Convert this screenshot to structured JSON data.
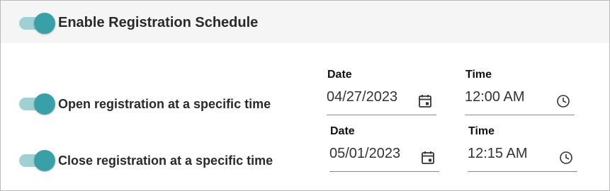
{
  "header": {
    "title": "Enable Registration Schedule",
    "toggle_on": true
  },
  "open": {
    "label": "Open registration at a specific time",
    "toggle_on": true,
    "date_caption": "Date",
    "date_value": "04/27/2023",
    "time_caption": "Time",
    "time_value": "12:00 AM"
  },
  "close": {
    "label": "Close registration at a specific time",
    "toggle_on": true,
    "date_caption": "Date",
    "date_value": "05/01/2023",
    "time_caption": "Time",
    "time_value": "12:15 AM"
  },
  "icons": {
    "date": "calendar-icon",
    "time": "clock-icon"
  },
  "colors": {
    "toggle_track": "#9fd1d4",
    "toggle_thumb": "#3aa0a8",
    "header_bg": "#f5f5f5"
  }
}
